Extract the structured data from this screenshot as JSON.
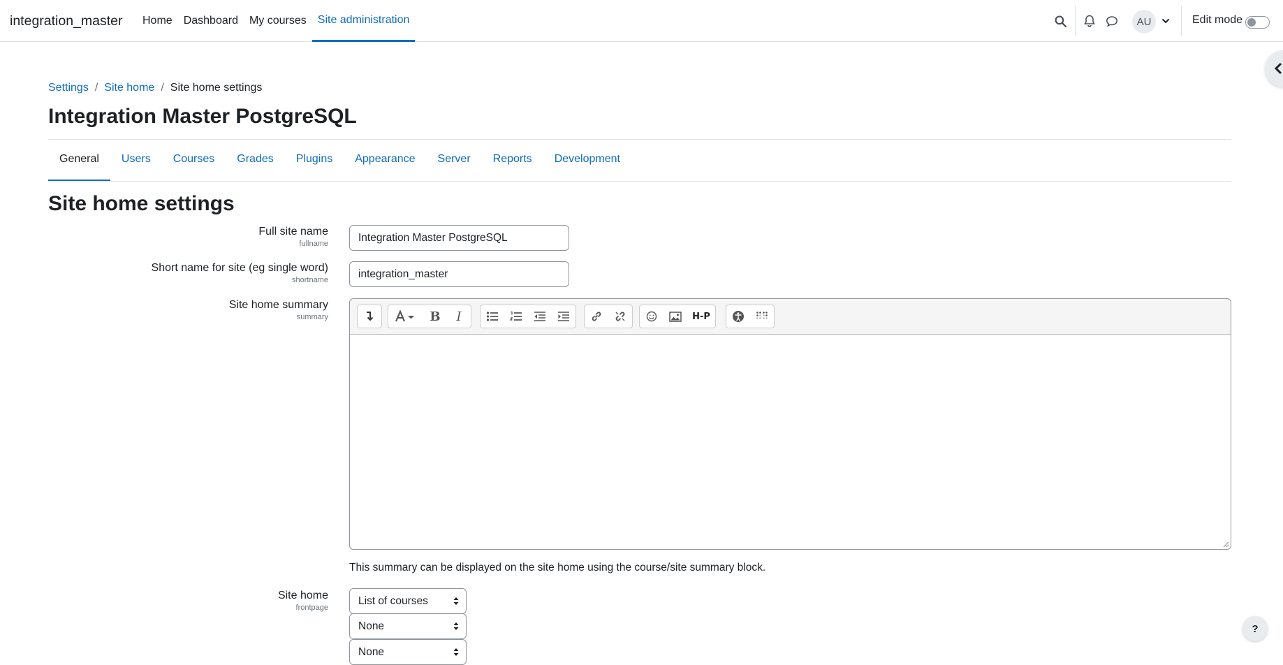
{
  "navbar": {
    "brand": "integration_master",
    "links": [
      "Home",
      "Dashboard",
      "My courses",
      "Site administration"
    ],
    "avatar_initials": "AU",
    "edit_mode_label": "Edit mode",
    "edit_mode_on": false
  },
  "breadcrumb": [
    "Settings",
    "Site home",
    "Site home settings"
  ],
  "page_title": "Integration Master PostgreSQL",
  "tabs": [
    "General",
    "Users",
    "Courses",
    "Grades",
    "Plugins",
    "Appearance",
    "Server",
    "Reports",
    "Development"
  ],
  "section_title": "Site home settings",
  "form": {
    "fullname": {
      "label": "Full site name",
      "sub": "fullname",
      "value": "Integration Master PostgreSQL"
    },
    "shortname": {
      "label": "Short name for site (eg single word)",
      "sub": "shortname",
      "value": "integration_master"
    },
    "summary": {
      "label": "Site home summary",
      "sub": "summary",
      "help": "This summary can be displayed on the site home using the course/site summary block."
    },
    "frontpage": {
      "label": "Site home",
      "sub": "frontpage",
      "selects": [
        "List of courses",
        "None",
        "None"
      ]
    }
  },
  "toolbar_buttons": {
    "bold": "B",
    "italic": "I",
    "h5p": "H-P"
  },
  "help_button": "?",
  "colors": {
    "link": "#0f6cbf",
    "text": "#1d2125",
    "border": "#8f959e"
  }
}
